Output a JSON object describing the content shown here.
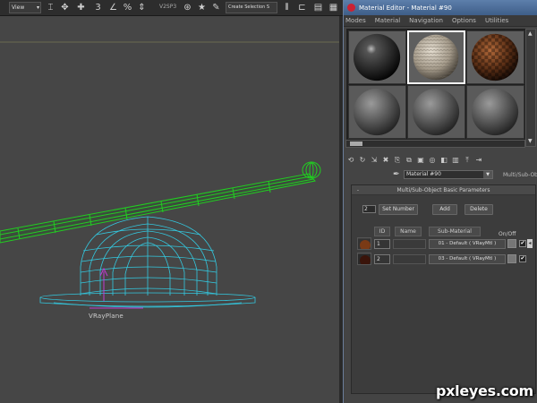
{
  "toolbar": {
    "view_select": "View",
    "coord_value": "V2SP3",
    "selection_set": "Create Selection S"
  },
  "viewport": {
    "object_label": "VRayPlane"
  },
  "material_editor": {
    "title": "Material Editor - Material #90",
    "menu": [
      "Modes",
      "Material",
      "Navigation",
      "Options",
      "Utilities"
    ],
    "material_name": "Material #90",
    "material_type": "Multi/Sub-Object",
    "panel": {
      "title": "Multi/Sub-Object Basic Parameters",
      "collapse": "-",
      "count": "2",
      "set_number": "Set Number",
      "add": "Add",
      "delete": "Delete",
      "col_id": "ID",
      "col_name": "Name",
      "col_submaterial": "Sub-Material",
      "col_onoff": "On/Off",
      "rows": [
        {
          "id": "1",
          "name": "",
          "material": "01 - Default ( VRayMtl )",
          "enabled": "✔"
        },
        {
          "id": "2",
          "name": "",
          "material": "03 - Default ( VRayMtl )",
          "enabled": "✔"
        }
      ]
    }
  },
  "watermark": "pxleyes.com",
  "colors": {
    "viewport_bg": "#464646",
    "rod_wire": "#22cc22",
    "hat_wire": "#33c9e0",
    "title_bar": "#4a6c98"
  }
}
